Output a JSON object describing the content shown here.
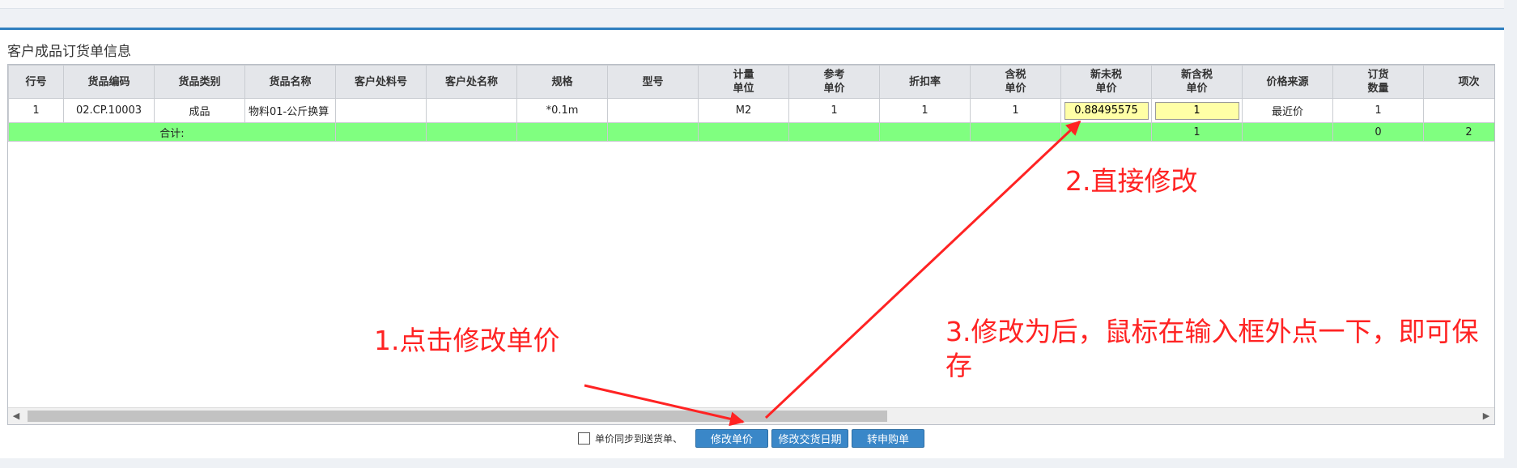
{
  "panel": {
    "title": "客户成品订货单信息"
  },
  "grid": {
    "columns": [
      "行号",
      "货品编码",
      "货品类别",
      "货品名称",
      "客户处料号",
      "客户处名称",
      "规格",
      "型号",
      "计量\n单位",
      "参考\n单价",
      "折扣率",
      "含税\n单价",
      "新未税\n单价",
      "新含税\n单价",
      "价格来源",
      "订货\n数量",
      "项次"
    ],
    "row": {
      "line_no": "1",
      "code": "02.CP.10003",
      "category": "成品",
      "name": "物料01-公斤换算",
      "customer_part_no": "",
      "customer_part_name": "",
      "spec": "*0.1m",
      "model": "",
      "unit": "M2",
      "ref_price": "1",
      "discount": "1",
      "tax_price": "1",
      "new_untaxed_price": "0.88495575",
      "new_taxed_price": "1",
      "price_source": "最近价",
      "quantity": "1",
      "item_no": ""
    },
    "total": {
      "label": "合计:",
      "new_taxed_price": "1",
      "quantity": "0",
      "item_no": "2"
    }
  },
  "toolbar": {
    "sync_label": "单价同步到送货单、",
    "sync_checked": false,
    "edit_price_label": "修改单价",
    "edit_date_label": "修改交货日期",
    "transfer_label": "转申购单"
  },
  "annotations": {
    "step1": "1.点击修改单价",
    "step2": "2.直接修改",
    "step3": "3.修改为后，鼠标在输入框外点一下，即可保存"
  },
  "colors": {
    "accent": "#2f7fbf",
    "button": "#3a87c8",
    "total_row": "#80ff80",
    "editable_cell": "#ffffa6",
    "annotation": "#ff2323"
  }
}
